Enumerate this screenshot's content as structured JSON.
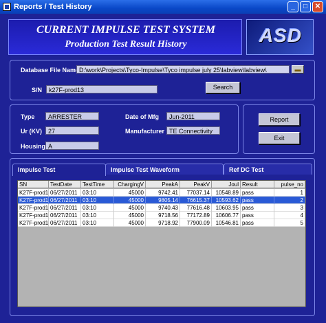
{
  "window": {
    "title": "Reports / Test History"
  },
  "banner": {
    "line1": "CURRENT IMPULSE  TEST SYSTEM",
    "line2": "Production Test Result History"
  },
  "logo": {
    "text": "ASD"
  },
  "database": {
    "label": "Database File Name",
    "value": "D:\\work\\Projects\\Tyco-Impulse\\Tyco impulse july 25\\labview\\labview\\"
  },
  "search": {
    "label": "S/N",
    "value": "k27F-prod13",
    "button": "Search"
  },
  "info": {
    "type_label": "Type",
    "type_value": "ARRESTER",
    "ur_label": "Ur (KV)",
    "ur_value": "27",
    "housing_label": "Housing",
    "housing_value": "A",
    "mfg_label": "Date of Mfg",
    "mfg_value": "Jun-2011",
    "manufacturer_label": "Manufacturer",
    "manufacturer_value": "TE Connectivity"
  },
  "buttons": {
    "report": "Report",
    "exit": "Exit"
  },
  "tabs": [
    "Impulse Test",
    "Impulse Test Waveform",
    "Ref DC Test"
  ],
  "table": {
    "columns": [
      "SN",
      "TestDate",
      "TestTime",
      "ChargingV",
      "PeakA",
      "PeakV",
      "Joul",
      "Result",
      "pulse_no"
    ],
    "rows": [
      [
        "K27F-prod13",
        "06/27/2011",
        "03:10",
        "45000",
        "9742.41",
        "77037.14",
        "10548.89",
        "pass",
        "1"
      ],
      [
        "K27F-prod13",
        "06/27/2011",
        "03:10",
        "45000",
        "9805.14",
        "76615.37",
        "10593.62",
        "pass",
        "2"
      ],
      [
        "K27F-prod13",
        "06/27/2011",
        "03:10",
        "45000",
        "9740.43",
        "77616.48",
        "10603.95",
        "pass",
        "3"
      ],
      [
        "K27F-prod13",
        "06/27/2011",
        "03:10",
        "45000",
        "9718.56",
        "77172.89",
        "10606.77",
        "pass",
        "4"
      ],
      [
        "K27F-prod13",
        "06/27/2011",
        "03:10",
        "45000",
        "9718.92",
        "77900.09",
        "10546.81",
        "pass",
        "5"
      ]
    ],
    "selected_row": 2
  },
  "colors": {
    "background": "#1e2296",
    "title_bar": "#0a48c8",
    "selected_row": "#2a5ad6"
  }
}
